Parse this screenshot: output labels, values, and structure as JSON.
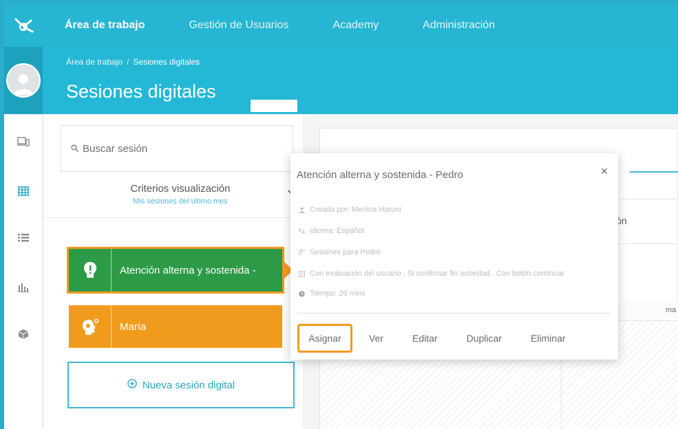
{
  "nav": {
    "items": [
      {
        "label": "Área de trabajo"
      },
      {
        "label": "Gestión de Usuarios"
      },
      {
        "label": "Academy"
      },
      {
        "label": "Administración"
      }
    ]
  },
  "header": {
    "breadcrumb": {
      "parent": "Área de trabajo",
      "separator": "/",
      "current": "Sesiones digitales"
    },
    "title": "Sesiones digitales"
  },
  "sidebar": {
    "icons": [
      "devices-icon",
      "grid-icon",
      "list-icon",
      "bar-chart-icon",
      "cube-icon"
    ]
  },
  "panel": {
    "search_placeholder": "Buscar sesión",
    "criteria_title": "Criterios visualización",
    "criteria_subtitle": "Mis sesiones del último mes",
    "sessions": [
      {
        "label": "Atención alterna y sostenida -",
        "color": "#2d9a47"
      },
      {
        "label": "María",
        "color": "#f19b1e"
      }
    ],
    "new_session_label": "Nueva sesión digital"
  },
  "main": {
    "partial_label": "sión",
    "column_label": "ma"
  },
  "popover": {
    "title": "Atención alterna y sostenida - Pedro",
    "close": "×",
    "meta": [
      {
        "icon": "user-icon",
        "text": "Creada por: Merlina Haruni"
      },
      {
        "icon": "translate-icon",
        "text": "Idioma: Español"
      },
      {
        "icon": "list-icon",
        "text": "Sesiones para Pedro"
      },
      {
        "icon": "settings-list-icon",
        "text": "Con evaluación del usuario , Si confirmar fin actividad , Con botón continuar"
      },
      {
        "icon": "clock-icon",
        "text": "Tiempo: 20 mins"
      }
    ],
    "actions": [
      "Asignar",
      "Ver",
      "Editar",
      "Duplicar",
      "Eliminar"
    ]
  },
  "colors": {
    "primary": "#26b5d2",
    "accent_highlight": "#f39a1d",
    "session_green": "#2d9a47",
    "session_orange": "#f19b1e"
  }
}
